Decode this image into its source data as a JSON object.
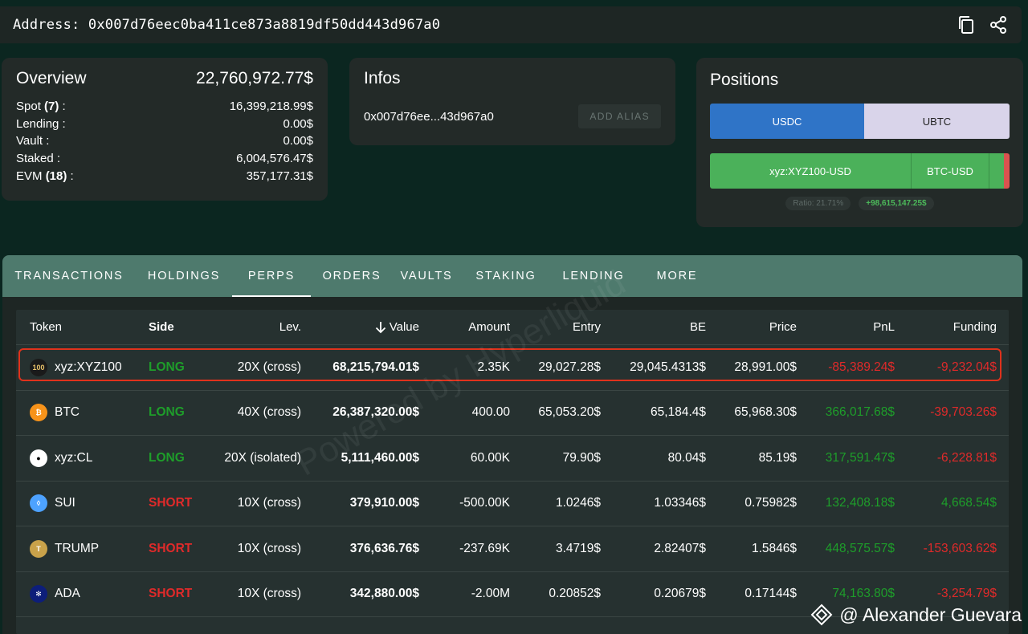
{
  "address_bar": {
    "label": "Address: 0x007d76eec0ba411ce873a8819df50dd443d967a0",
    "icons": [
      "copy-icon",
      "share-icon"
    ]
  },
  "overview": {
    "title": "Overview",
    "total": "22,760,972.77$",
    "rows": [
      {
        "label": "Spot",
        "count": "(7)",
        "suffix": " :",
        "value": "16,399,218.99$"
      },
      {
        "label": "Lending :",
        "count": "",
        "suffix": "",
        "value": "0.00$"
      },
      {
        "label": "Vault :",
        "count": "",
        "suffix": "",
        "value": "0.00$"
      },
      {
        "label": "Staked :",
        "count": "",
        "suffix": "",
        "value": "6,004,576.47$"
      },
      {
        "label": "EVM",
        "count": "(18)",
        "suffix": " :",
        "value": "357,177.31$"
      }
    ]
  },
  "infos": {
    "title": "Infos",
    "short_address": "0x007d76ee...43d967a0",
    "alias_button": "ADD ALIAS"
  },
  "positions": {
    "title": "Positions",
    "spot_segments": [
      "USDC",
      "UBTC"
    ],
    "perp_segments": [
      "xyz:XYZ100-USD",
      "BTC-USD"
    ],
    "ratio_badge": "Ratio: 21.71%",
    "pnl_badge": "+98,615,147.25$"
  },
  "tabs": [
    "TRANSACTIONS",
    "HOLDINGS",
    "PERPS",
    "ORDERS",
    "VAULTS",
    "STAKING",
    "LENDING",
    "MORE"
  ],
  "active_tab": "PERPS",
  "table": {
    "headers": {
      "token": "Token",
      "side": "Side",
      "lev": "Lev.",
      "value": "Value",
      "amount": "Amount",
      "entry": "Entry",
      "be": "BE",
      "price": "Price",
      "pnl": "PnL",
      "funding": "Funding"
    },
    "sort_icon": "arrow-down-icon",
    "rows": [
      {
        "token": "xyz:XYZ100",
        "icon": "xyz100-icon",
        "icon_text": "100",
        "icon_color": "#1a1a1a",
        "side": "LONG",
        "lev": "20X (cross)",
        "value": "68,215,794.01$",
        "amount": "2.35K",
        "entry": "29,027.28$",
        "be": "29,045.4313$",
        "price": "28,991.00$",
        "pnl": "-85,389.24$",
        "funding": "-9,232.04$"
      },
      {
        "token": "BTC",
        "icon": "bitcoin-icon",
        "icon_text": "₿",
        "icon_color": "#f7931a",
        "side": "LONG",
        "lev": "40X (cross)",
        "value": "26,387,320.00$",
        "amount": "400.00",
        "entry": "65,053.20$",
        "be": "65,184.4$",
        "price": "65,968.30$",
        "pnl": "366,017.68$",
        "funding": "-39,703.26$"
      },
      {
        "token": "xyz:CL",
        "icon": "oil-drop-icon",
        "icon_text": "●",
        "icon_color": "#ffffff",
        "side": "LONG",
        "lev": "20X (isolated)",
        "value": "5,111,460.00$",
        "amount": "60.00K",
        "entry": "79.90$",
        "be": "80.04$",
        "price": "85.19$",
        "pnl": "317,591.47$",
        "funding": "-6,228.81$"
      },
      {
        "token": "SUI",
        "icon": "sui-icon",
        "icon_text": "◊",
        "icon_color": "#4da2ff",
        "side": "SHORT",
        "lev": "10X (cross)",
        "value": "379,910.00$",
        "amount": "-500.00K",
        "entry": "1.0246$",
        "be": "1.03346$",
        "price": "0.75982$",
        "pnl": "132,408.18$",
        "funding": "4,668.54$"
      },
      {
        "token": "TRUMP",
        "icon": "trump-icon",
        "icon_text": "T",
        "icon_color": "#c9a24a",
        "side": "SHORT",
        "lev": "10X (cross)",
        "value": "376,636.76$",
        "amount": "-237.69K",
        "entry": "3.4719$",
        "be": "2.82407$",
        "price": "1.5846$",
        "pnl": "448,575.57$",
        "funding": "-153,603.62$"
      },
      {
        "token": "ADA",
        "icon": "cardano-icon",
        "icon_text": "✻",
        "icon_color": "#0d1e7a",
        "side": "SHORT",
        "lev": "10X (cross)",
        "value": "342,880.00$",
        "amount": "-2.00M",
        "entry": "0.20852$",
        "be": "0.20679$",
        "price": "0.17144$",
        "pnl": "74,163.80$",
        "funding": "-3,254.79$"
      }
    ]
  },
  "watermark": "Powered by Hyperliquid",
  "credit": "@ Alexander Guevara",
  "colors": {
    "background": "#0b2620",
    "card": "#232a28",
    "tab_bar": "#4e7a6d",
    "long": "#1e9e2a",
    "short": "#e02a2a",
    "highlight": "#e0321c"
  }
}
